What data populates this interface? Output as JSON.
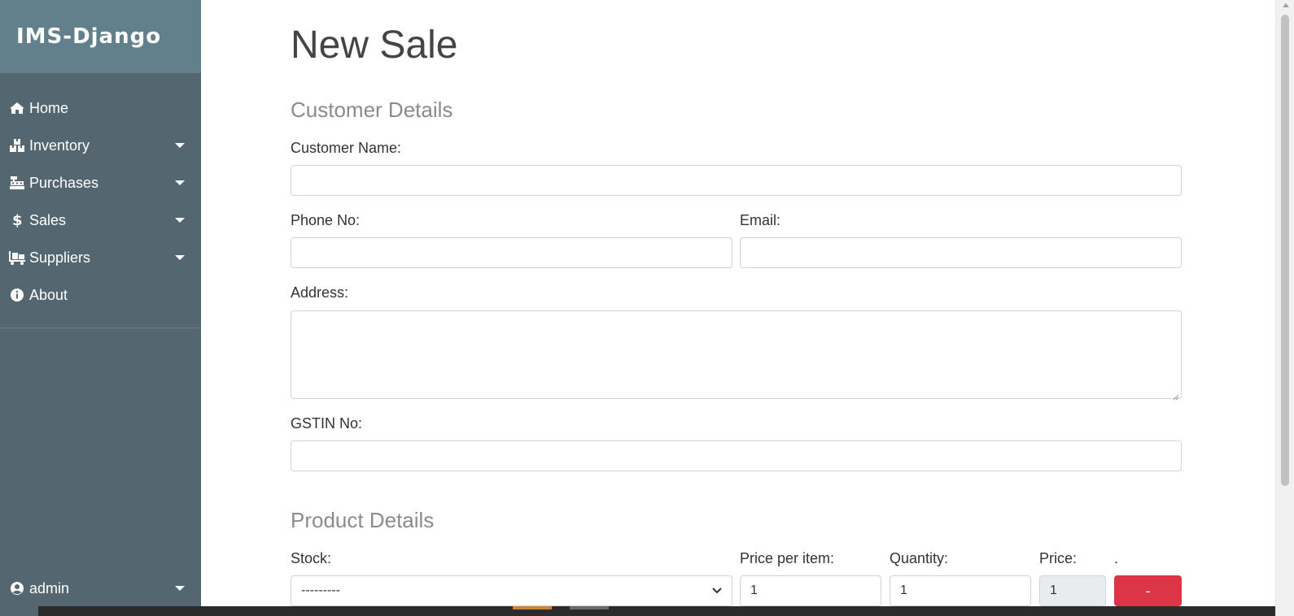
{
  "app": {
    "brand": "IMS-Django"
  },
  "sidebar": {
    "items": [
      {
        "label": "Home",
        "icon": "home-icon",
        "has_dropdown": false
      },
      {
        "label": "Inventory",
        "icon": "boxes-icon",
        "has_dropdown": true
      },
      {
        "label": "Purchases",
        "icon": "cash-register-icon",
        "has_dropdown": true
      },
      {
        "label": "Sales",
        "icon": "dollar-icon",
        "has_dropdown": true
      },
      {
        "label": "Suppliers",
        "icon": "dolly-icon",
        "has_dropdown": true
      },
      {
        "label": "About",
        "icon": "info-circle-icon",
        "has_dropdown": false
      }
    ],
    "user": {
      "label": "admin",
      "icon": "user-circle-icon",
      "has_dropdown": true
    }
  },
  "page": {
    "title": "New Sale"
  },
  "customer": {
    "heading": "Customer Details",
    "name_label": "Customer Name:",
    "name_value": "",
    "phone_label": "Phone No:",
    "phone_value": "",
    "email_label": "Email:",
    "email_value": "",
    "address_label": "Address:",
    "address_value": "",
    "gstin_label": "GSTIN No:",
    "gstin_value": ""
  },
  "product": {
    "heading": "Product Details",
    "stock_label": "Stock:",
    "stock_selected": "---------",
    "price_per_item_label": "Price per item:",
    "price_per_item_value": "1",
    "quantity_label": "Quantity:",
    "quantity_value": "1",
    "price_label": "Price:",
    "price_value": "1",
    "remove_label_header": ".",
    "remove_button_label": "-"
  },
  "colors": {
    "sidebar_bg": "#546670",
    "brand_bg": "#62808c",
    "remove_button": "#dc3545",
    "section_heading": "#8b8b8b"
  }
}
